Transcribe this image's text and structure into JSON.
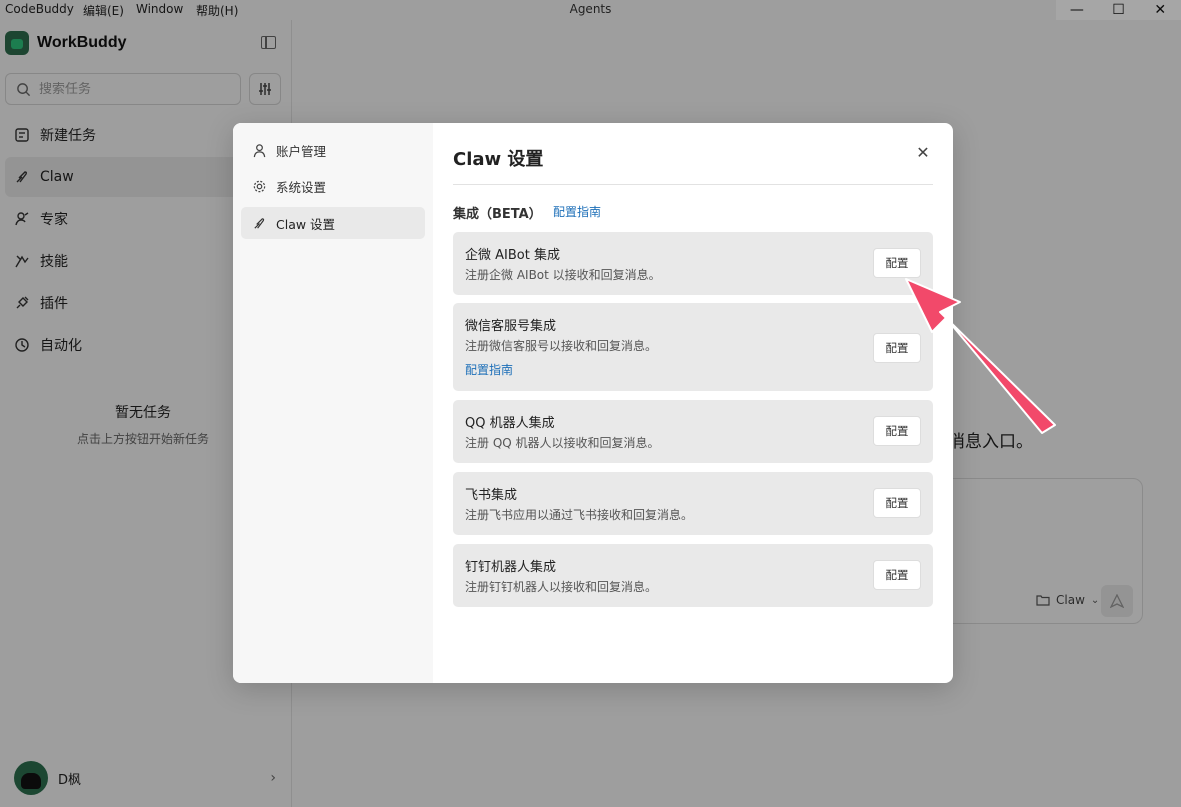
{
  "window": {
    "menus": [
      "CodeBuddy",
      "编辑(E)",
      "Window",
      "帮助(H)"
    ],
    "title": "Agents",
    "controls": [
      "—",
      "☐",
      "✕"
    ]
  },
  "sidebar": {
    "brand": "WorkBuddy",
    "search_placeholder": "搜索任务",
    "items": [
      {
        "label": "新建任务",
        "icon": "new-task-icon"
      },
      {
        "label": "Claw",
        "icon": "claw-icon"
      },
      {
        "label": "专家",
        "icon": "expert-icon"
      },
      {
        "label": "技能",
        "icon": "skill-icon"
      },
      {
        "label": "插件",
        "icon": "plugin-icon"
      },
      {
        "label": "自动化",
        "icon": "clock-icon"
      }
    ],
    "empty_title": "暂无任务",
    "empty_sub": "点击上方按钮开始新任务",
    "user_name": "D枫"
  },
  "main": {
    "hint": "消息入口。",
    "composer_project": "Claw",
    "composer_send_icon": "send-icon"
  },
  "modal": {
    "nav": [
      {
        "label": "账户管理",
        "icon": "user-icon"
      },
      {
        "label": "系统设置",
        "icon": "gear-icon"
      },
      {
        "label": "Claw 设置",
        "icon": "claw-icon"
      }
    ],
    "title": "Claw 设置",
    "section_label": "集成（BETA）",
    "section_link": "配置指南",
    "cards": [
      {
        "title": "企微 AIBot 集成",
        "desc": "注册企微 AIBot 以接收和回复消息。",
        "button": "配置"
      },
      {
        "title": "微信客服号集成",
        "desc": "注册微信客服号以接收和回复消息。",
        "link": "配置指南",
        "button": "配置"
      },
      {
        "title": "QQ 机器人集成",
        "desc": "注册 QQ 机器人以接收和回复消息。",
        "button": "配置"
      },
      {
        "title": "飞书集成",
        "desc": "注册飞书应用以通过飞书接收和回复消息。",
        "button": "配置"
      },
      {
        "title": "钉钉机器人集成",
        "desc": "注册钉钉机器人以接收和回复消息。",
        "button": "配置"
      }
    ]
  },
  "annotation": {
    "arrow_color": "#f2496a"
  }
}
